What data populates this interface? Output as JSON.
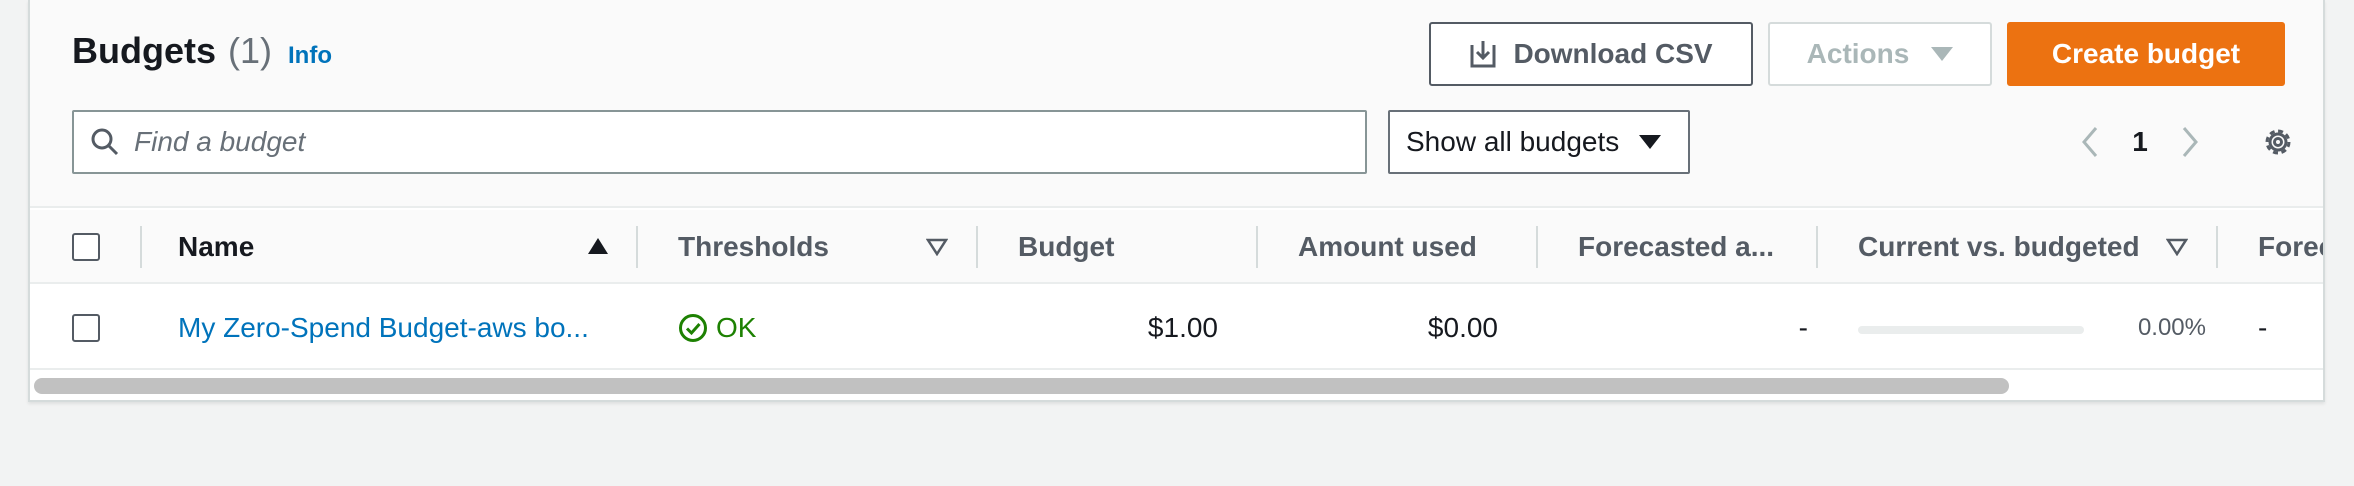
{
  "header": {
    "title": "Budgets",
    "count": "(1)",
    "info_link": "Info"
  },
  "toolbar": {
    "download_label": "Download CSV",
    "actions_label": "Actions",
    "create_label": "Create budget"
  },
  "search": {
    "placeholder": "Find a budget",
    "value": ""
  },
  "filter": {
    "selected": "Show all budgets"
  },
  "pagination": {
    "current_page": "1"
  },
  "table": {
    "columns": [
      "Name",
      "Thresholds",
      "Budget",
      "Amount used",
      "Forecasted a...",
      "Current vs. budgeted",
      "Forec"
    ],
    "rows": [
      {
        "name": "My Zero-Spend Budget-aws bo...",
        "thresholds": "OK",
        "budget": "$1.00",
        "amount_used": "$0.00",
        "forecasted": "-",
        "current_vs_budgeted_pct": "0.00%",
        "current_vs_budgeted_fraction": 0.0,
        "forecasted_vs": "-"
      }
    ]
  },
  "colors": {
    "primary_button": "#ec7211",
    "link": "#0073bb",
    "ok_status": "#1d8102"
  },
  "icons": {
    "download": "download-icon",
    "search": "search-icon",
    "status_ok": "check-circle-icon",
    "prev": "chevron-left-icon",
    "next": "chevron-right-icon",
    "settings": "gear-icon"
  }
}
